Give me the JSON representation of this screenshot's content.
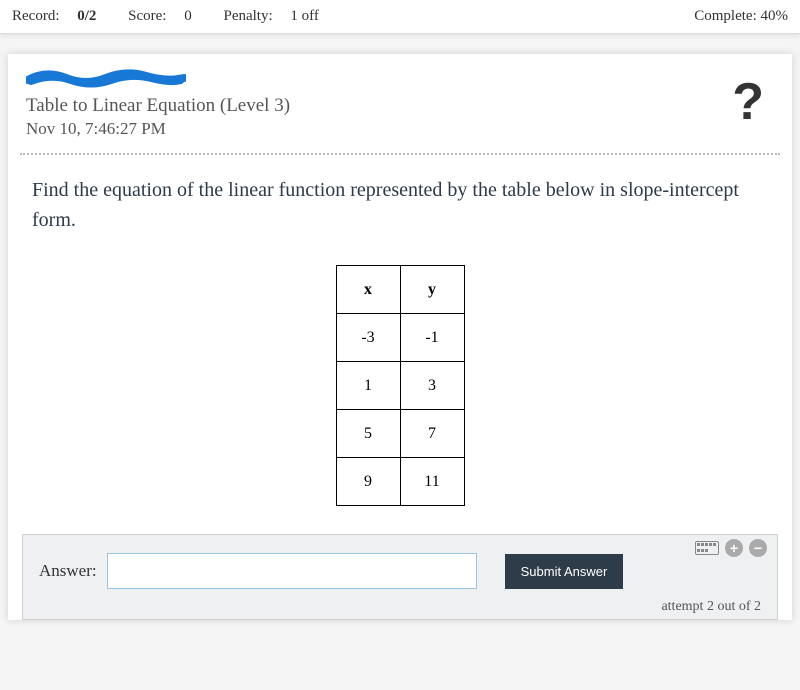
{
  "topbar": {
    "record_label": "Record:",
    "record_value": "0/2",
    "score_label": "Score:",
    "score_value": "0",
    "penalty_label": "Penalty:",
    "penalty_value": "1 off",
    "complete_label": "Complete:",
    "complete_value": "40%"
  },
  "header": {
    "title": "Table to Linear Equation (Level 3)",
    "timestamp": "Nov 10, 7:46:27 PM"
  },
  "question": {
    "text": "Find the equation of the linear function represented by the table below in slope-intercept form."
  },
  "table": {
    "col1_header": "x",
    "col2_header": "y",
    "rows": [
      {
        "x": "-3",
        "y": "-1"
      },
      {
        "x": "1",
        "y": "3"
      },
      {
        "x": "5",
        "y": "7"
      },
      {
        "x": "9",
        "y": "11"
      }
    ]
  },
  "answer": {
    "label": "Answer:",
    "input_value": "",
    "submit_label": "Submit Answer",
    "attempt_text": "attempt 2 out of 2"
  }
}
